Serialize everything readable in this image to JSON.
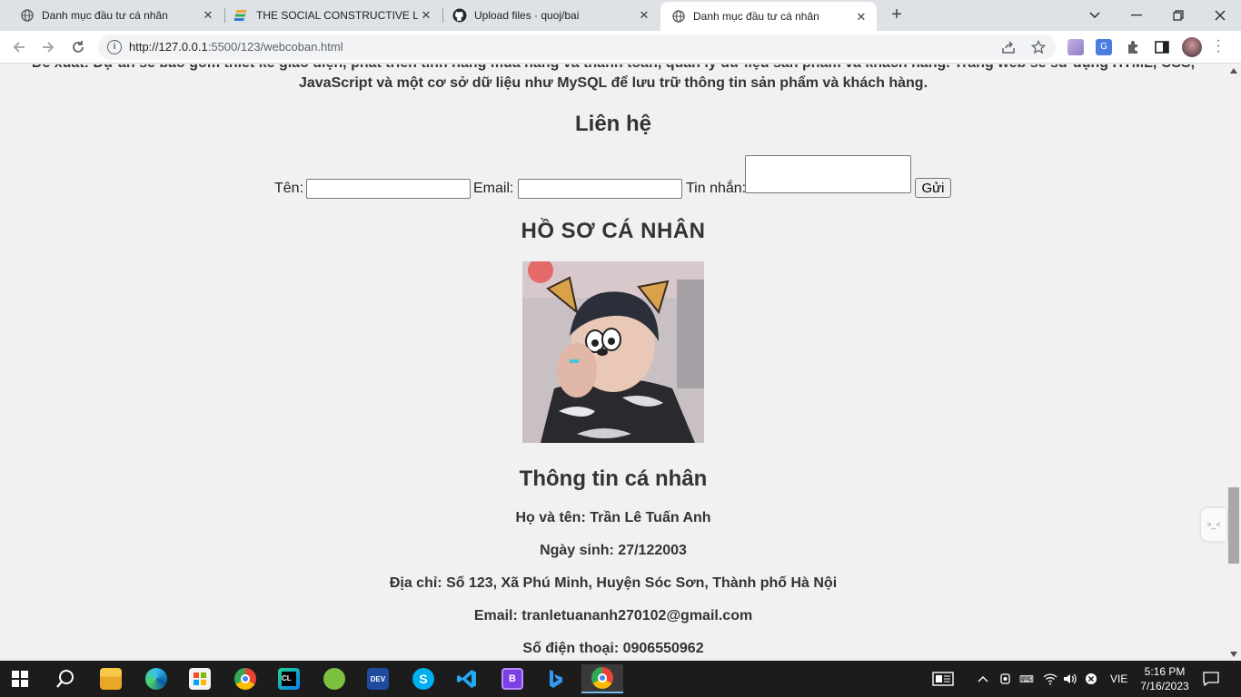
{
  "browser": {
    "tabs": [
      {
        "title": "Danh mục đầu tư cá nhân",
        "icon": "globe-icon",
        "active": false
      },
      {
        "title": "THE SOCIAL CONSTRUCTIVE LEA",
        "icon": "stack-logo-icon",
        "active": false
      },
      {
        "title": "Upload files · quoj/bai",
        "icon": "github-icon",
        "active": false
      },
      {
        "title": "Danh mục đầu tư cá nhân",
        "icon": "globe-icon",
        "active": true
      }
    ],
    "url_host": "http://127.0.0.1",
    "url_rest": ":5500/123/webcoban.html"
  },
  "page": {
    "intro_line1": "Đề xuất: Dự án sẽ bao gồm thiết kế giao diện, phát triển tính năng mua hàng và thanh toán, quản lý dữ liệu sản phẩm và khách hàng. Trang web sẽ sử dụng HTML, CSS,",
    "intro_line2": "JavaScript và một cơ sở dữ liệu như MySQL để lưu trữ thông tin sản phẩm và khách hàng.",
    "contact_heading": "Liên hệ",
    "form": {
      "name_label": "Tên:",
      "email_label": "Email:",
      "message_label": "Tin nhắn:",
      "name_value": "",
      "email_value": "",
      "message_value": "",
      "submit_label": "Gửi"
    },
    "profile_heading": "HỒ SƠ CÁ NHÂN",
    "info_heading": "Thông tin cá nhân",
    "info": [
      "Họ và tên: Trần Lê Tuấn Anh",
      "Ngày sinh: 27/122003",
      "Địa chỉ: Số 123, Xã Phú Minh, Huyện Sóc Sơn, Thành phố Hà Nội",
      "Email: tranletuananh270102@gmail.com",
      "Số điện thoại: 0906550962"
    ]
  },
  "taskbar": {
    "language": "VIE",
    "time": "5:16 PM",
    "date": "7/16/2023",
    "apps": [
      "start-icon",
      "search-icon",
      "file-explorer-icon",
      "edge-icon",
      "store-icon",
      "chrome-icon",
      "clion-icon",
      "coccoc-icon",
      "devcpp-icon",
      "skype-icon",
      "vscode-icon",
      "bootstrap-studio-icon",
      "bing-icon",
      "chrome-active-icon"
    ]
  },
  "colors": {
    "page_bg": "#f1f1f1",
    "tabstrip_bg": "#dee1e6",
    "taskbar_bg": "#1c1c1c",
    "accent": "#76b9ed"
  }
}
